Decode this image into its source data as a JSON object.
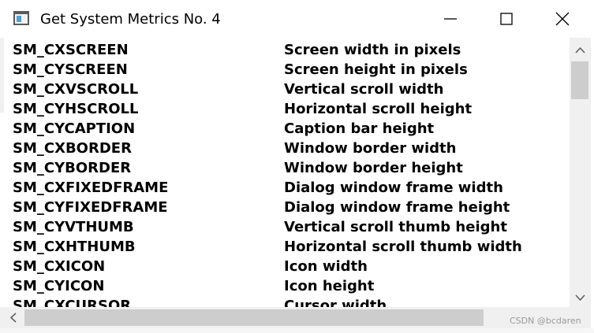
{
  "window": {
    "title": "Get System Metrics No. 4"
  },
  "metrics": [
    {
      "name": "SM_CXSCREEN",
      "description": "Screen width in pixels"
    },
    {
      "name": "SM_CYSCREEN",
      "description": "Screen height in pixels"
    },
    {
      "name": "SM_CXVSCROLL",
      "description": "Vertical scroll width"
    },
    {
      "name": "SM_CYHSCROLL",
      "description": "Horizontal scroll height"
    },
    {
      "name": "SM_CYCAPTION",
      "description": "Caption bar height"
    },
    {
      "name": "SM_CXBORDER",
      "description": "Window border width"
    },
    {
      "name": "SM_CYBORDER",
      "description": "Window border height"
    },
    {
      "name": "SM_CXFIXEDFRAME",
      "description": "Dialog window frame width"
    },
    {
      "name": "SM_CYFIXEDFRAME",
      "description": "Dialog window frame height"
    },
    {
      "name": "SM_CYVTHUMB",
      "description": "Vertical scroll thumb height"
    },
    {
      "name": "SM_CXHTHUMB",
      "description": "Horizontal scroll thumb width"
    },
    {
      "name": "SM_CXICON",
      "description": "Icon width"
    },
    {
      "name": "SM_CYICON",
      "description": "Icon height"
    },
    {
      "name": "SM_CXCURSOR",
      "description": "Cursor width"
    }
  ],
  "icons": {
    "app": "app-window-icon",
    "minimize": "minimize-icon",
    "maximize": "maximize-icon",
    "close": "close-icon",
    "scroll_up": "chevron-up-icon",
    "scroll_down": "chevron-down-icon",
    "scroll_left": "chevron-left-icon",
    "scroll_right": "chevron-right-icon"
  },
  "watermark": "CSDN @bcdaren",
  "colors": {
    "text": "#000000",
    "scrollbar_track": "#f0f0f0",
    "scrollbar_thumb": "#cdcdcd",
    "glyph": "#606060"
  }
}
